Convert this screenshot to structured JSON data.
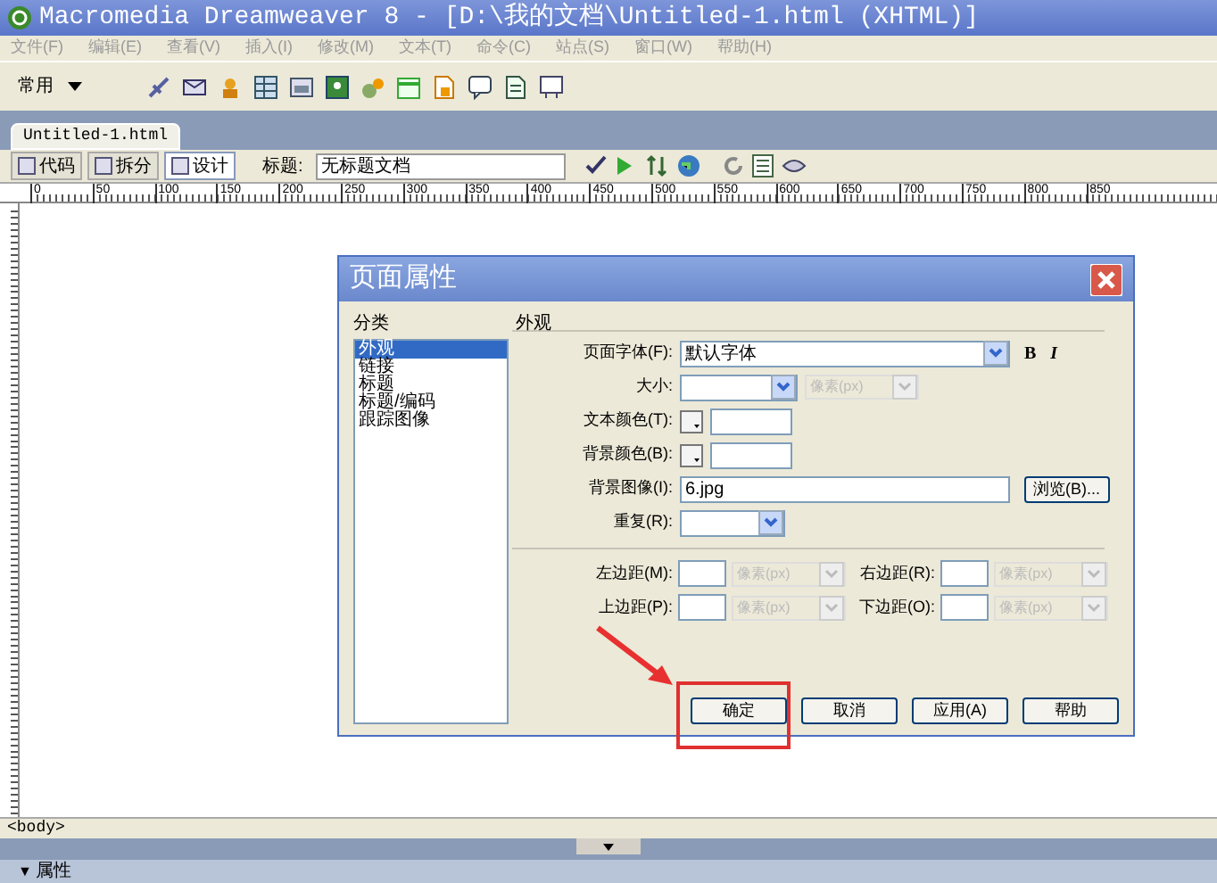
{
  "window": {
    "title": "Macromedia Dreamweaver 8 - [D:\\我的文档\\Untitled-1.html (XHTML)]"
  },
  "menu": [
    "文件(F)",
    "编辑(E)",
    "查看(V)",
    "插入(I)",
    "修改(M)",
    "文本(T)",
    "命令(C)",
    "站点(S)",
    "窗口(W)",
    "帮助(H)"
  ],
  "toolbar": {
    "category": "常用"
  },
  "document_tab": "Untitled-1.html",
  "view_buttons": [
    {
      "label": "代码",
      "selected": false
    },
    {
      "label": "拆分",
      "selected": false
    },
    {
      "label": "设计",
      "selected": true
    }
  ],
  "title_field": {
    "label": "标题:",
    "value": "无标题文档"
  },
  "ruler_ticks": [
    "0",
    "50",
    "100",
    "150",
    "200",
    "250",
    "300",
    "350",
    "400",
    "450",
    "500",
    "550",
    "600",
    "650",
    "700",
    "750",
    "800",
    "850"
  ],
  "status_bar": "<body>",
  "panel": {
    "arrow": "▼",
    "label": "属性"
  },
  "dialog": {
    "title": "页面属性",
    "category_heading": "分类",
    "categories": [
      {
        "label": "外观",
        "selected": true
      },
      {
        "label": "链接",
        "selected": false
      },
      {
        "label": "标题",
        "selected": false
      },
      {
        "label": "标题/编码",
        "selected": false
      },
      {
        "label": "跟踪图像",
        "selected": false
      }
    ],
    "section_heading": "外观",
    "rows": [
      {
        "kind": "font",
        "label": "页面字体(F):",
        "value": "默认字体",
        "bold": "B",
        "italic": "I"
      },
      {
        "kind": "size",
        "label": "大小:",
        "unit": "像素(px)",
        "disabled": true
      },
      {
        "kind": "color",
        "label": "文本颜色(T):"
      },
      {
        "kind": "color",
        "label": "背景颜色(B):"
      },
      {
        "kind": "file",
        "label": "背景图像(I):",
        "value": "6.jpg",
        "button": "浏览(B)..."
      },
      {
        "kind": "select",
        "label": "重复(R):"
      }
    ],
    "margins": [
      {
        "label": "左边距(M):",
        "unit": "像素(px)",
        "disabled": true
      },
      {
        "label": "右边距(R):",
        "unit": "像素(px)",
        "disabled": true
      },
      {
        "label": "上边距(P):",
        "unit": "像素(px)",
        "disabled": true
      },
      {
        "label": "下边距(O):",
        "unit": "像素(px)",
        "disabled": true
      }
    ],
    "buttons": [
      {
        "label": "确定",
        "highlighted": true
      },
      {
        "label": "取消",
        "highlighted": false
      },
      {
        "label": "应用(A)",
        "highlighted": false
      },
      {
        "label": "帮助",
        "highlighted": false
      }
    ]
  }
}
